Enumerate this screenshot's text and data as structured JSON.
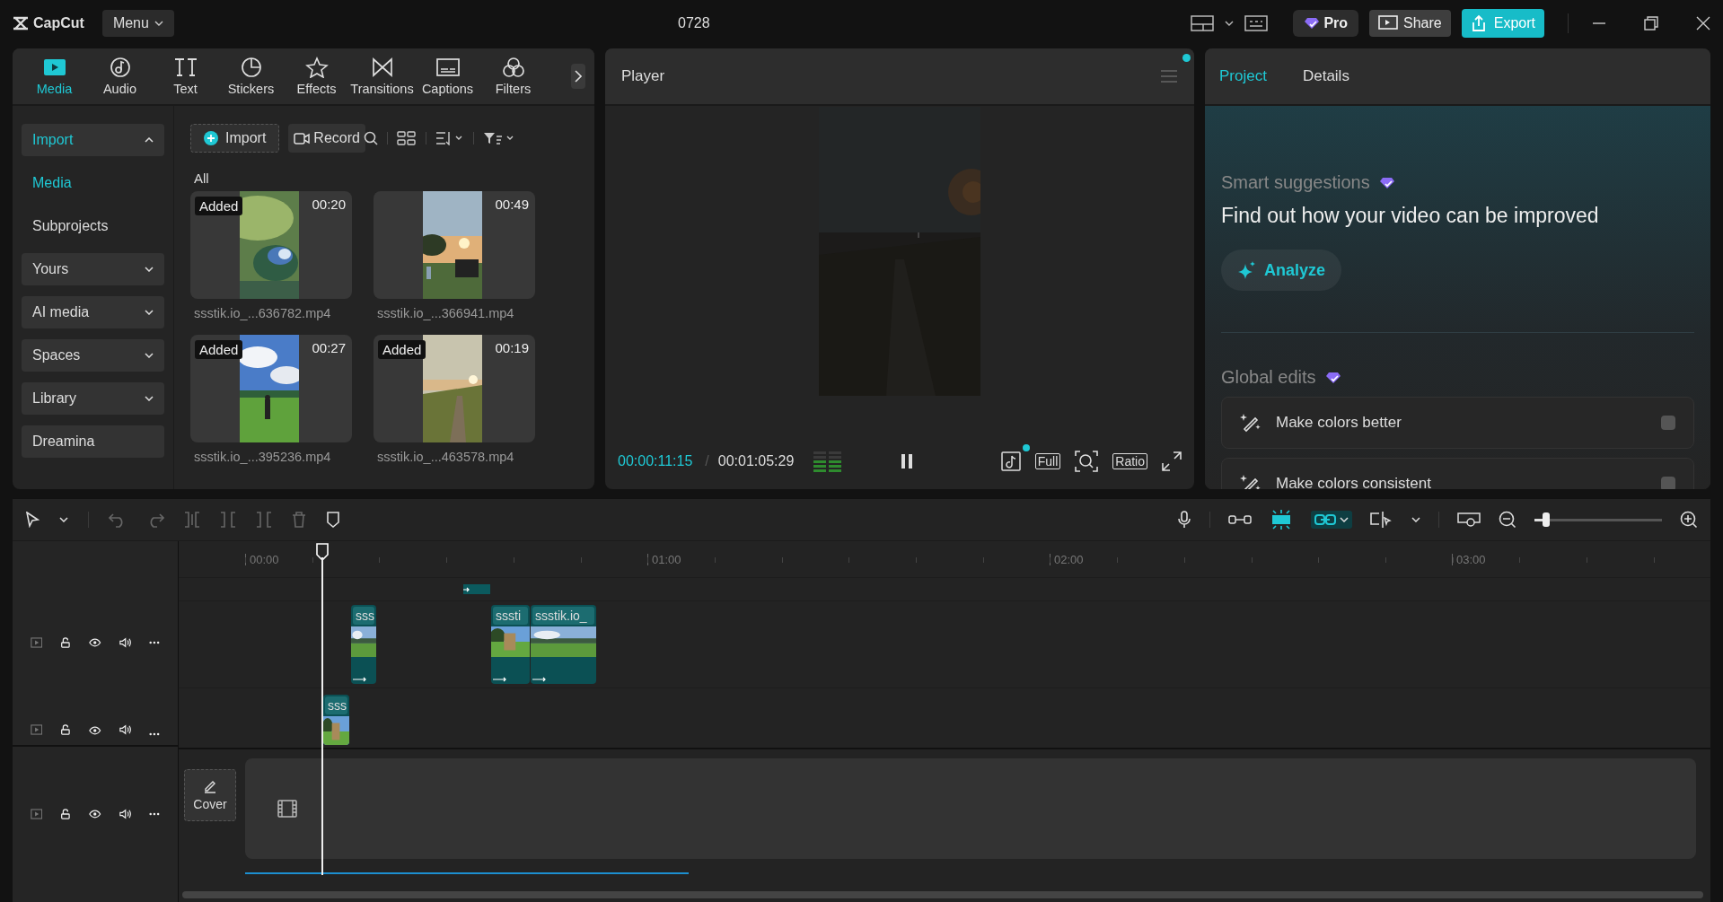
{
  "app": {
    "logo": "CapCut",
    "menu": "Menu",
    "project_title": "0728",
    "pro": "Pro",
    "share": "Share",
    "export": "Export"
  },
  "toolbar_tabs": [
    {
      "label": "Media",
      "selected": true
    },
    {
      "label": "Audio",
      "selected": false
    },
    {
      "label": "Text",
      "selected": false
    },
    {
      "label": "Stickers",
      "selected": false
    },
    {
      "label": "Effects",
      "selected": false
    },
    {
      "label": "Transitions",
      "selected": false
    },
    {
      "label": "Captions",
      "selected": false
    },
    {
      "label": "Filters",
      "selected": false
    }
  ],
  "media_sidebar": [
    {
      "label": "Import",
      "kind": "group",
      "expanded": true
    },
    {
      "label": "Media",
      "kind": "link",
      "selected": true
    },
    {
      "label": "Subprojects",
      "kind": "link",
      "selected": false
    },
    {
      "label": "Yours",
      "kind": "group",
      "expanded": false
    },
    {
      "label": "AI media",
      "kind": "group",
      "expanded": false
    },
    {
      "label": "Spaces",
      "kind": "group",
      "expanded": false
    },
    {
      "label": "Library",
      "kind": "group",
      "expanded": false
    },
    {
      "label": "Dreamina",
      "kind": "button"
    }
  ],
  "media_toolbar": {
    "import": "Import",
    "record": "Record"
  },
  "media_filter": "All",
  "media_items": [
    {
      "duration": "00:20",
      "filename": "ssstik.io_...636782.mp4",
      "badge": "Added"
    },
    {
      "duration": "00:49",
      "filename": "ssstik.io_...366941.mp4"
    },
    {
      "duration": "00:27",
      "filename": "ssstik.io_...395236.mp4",
      "badge": "Added"
    },
    {
      "duration": "00:19",
      "filename": "ssstik.io_...463578.mp4",
      "badge": "Added"
    }
  ],
  "player": {
    "title": "Player",
    "current_time": "00:00:11:15",
    "separator": "/",
    "total_time": "00:01:05:29",
    "volume_meter": {
      "level": 0.5
    },
    "full": "Full",
    "ratio": "Ratio"
  },
  "right_panel": {
    "tabs": [
      {
        "label": "Project",
        "selected": true
      },
      {
        "label": "Details",
        "selected": false
      }
    ],
    "smart_suggestions": {
      "heading": "Smart suggestions",
      "message": "Find out how your video can be improved",
      "button": "Analyze"
    },
    "global_edits": {
      "heading": "Global edits",
      "items": [
        {
          "label": "Make colors better",
          "checked": false
        },
        {
          "label": "Make colors consistent",
          "checked": false
        }
      ]
    }
  },
  "timeline": {
    "snap_on": true,
    "link_on": true,
    "zoom": {
      "level": 0.09
    },
    "ruler": [
      "00:00",
      "01:00",
      "02:00",
      "03:00"
    ],
    "tracks": [
      {
        "clips": [
          {
            "label": "sss"
          },
          {
            "label": "sssti"
          },
          {
            "label": "ssstik.io_"
          }
        ]
      },
      {
        "clips": [
          {
            "label": "sss"
          }
        ]
      }
    ],
    "cover": "Cover"
  }
}
